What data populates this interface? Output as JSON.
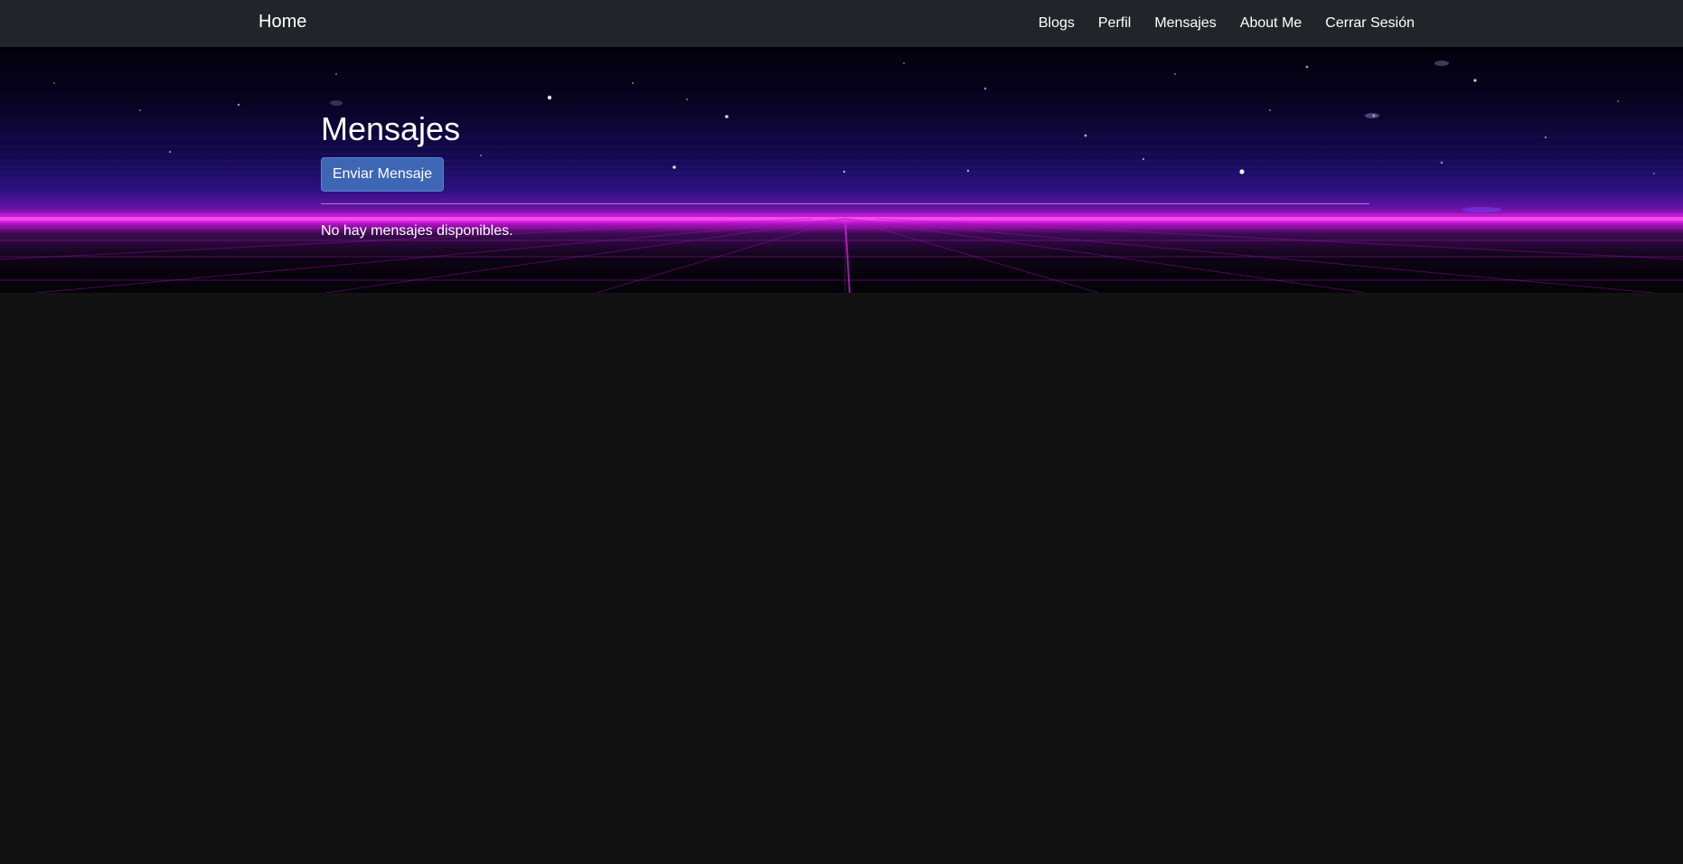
{
  "navbar": {
    "brand": "Home",
    "links": [
      {
        "label": "Blogs"
      },
      {
        "label": "Perfil"
      },
      {
        "label": "Mensajes"
      },
      {
        "label": "About Me"
      },
      {
        "label": "Cerrar Sesión"
      }
    ]
  },
  "main": {
    "title": "Mensajes",
    "send_button_label": "Enviar Mensaje",
    "empty_message": "No hay mensajes disponibles."
  },
  "colors": {
    "navbar_bg": "#212529",
    "page_bg": "#121212",
    "button_bg": "#3d66b4",
    "neon_accent": "#ff5cf5"
  }
}
